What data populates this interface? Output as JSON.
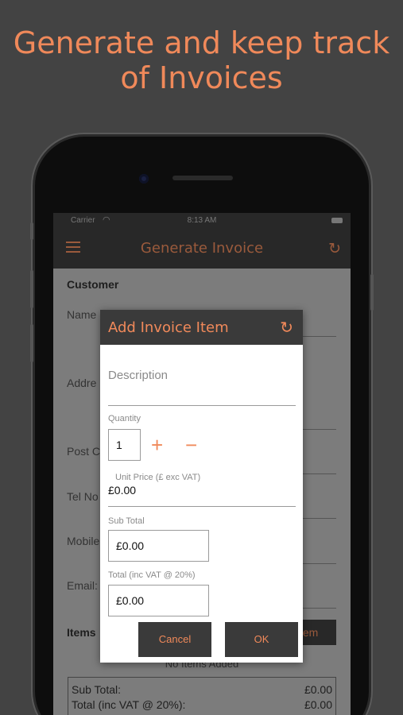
{
  "headline": {
    "line1": "Generate and keep track",
    "line2": "of Invoices"
  },
  "status_bar": {
    "carrier": "Carrier",
    "time": "8:13 AM"
  },
  "app_bar": {
    "title": "Generate Invoice"
  },
  "background_form": {
    "customer_heading": "Customer",
    "name_label": "Name",
    "address_label": "Addre",
    "postcode_label": "Post C",
    "tel_label": "Tel No",
    "mobile_label": "Mobile",
    "email_label": "Email:",
    "items_heading": "Items",
    "add_item_label": "tem",
    "no_items": "No Items Added",
    "totals": {
      "subtotal_label": "Sub Total:",
      "subtotal_value": "£0.00",
      "total_label": "Total (inc VAT @ 20%):",
      "total_value": "£0.00"
    }
  },
  "dialog": {
    "title": "Add Invoice Item",
    "description_placeholder": "Description",
    "quantity_label": "Quantity",
    "quantity_value": "1",
    "plus": "+",
    "minus": "−",
    "unit_price_label": "Unit Price (£ exc VAT)",
    "unit_price_value": "£0.00",
    "subtotal_label": "Sub Total",
    "subtotal_value": "£0.00",
    "total_label": "Total (inc VAT @ 20%)",
    "total_value": "£0.00",
    "cancel_label": "Cancel",
    "ok_label": "OK"
  },
  "icons": {
    "menu": "hamburger-menu-icon",
    "refresh": "refresh-icon",
    "wifi": "wifi-icon",
    "battery": "battery-icon"
  },
  "colors": {
    "accent": "#F0895A",
    "background": "#434343",
    "bar": "#282828",
    "dialog_header": "#3a3a3a"
  }
}
